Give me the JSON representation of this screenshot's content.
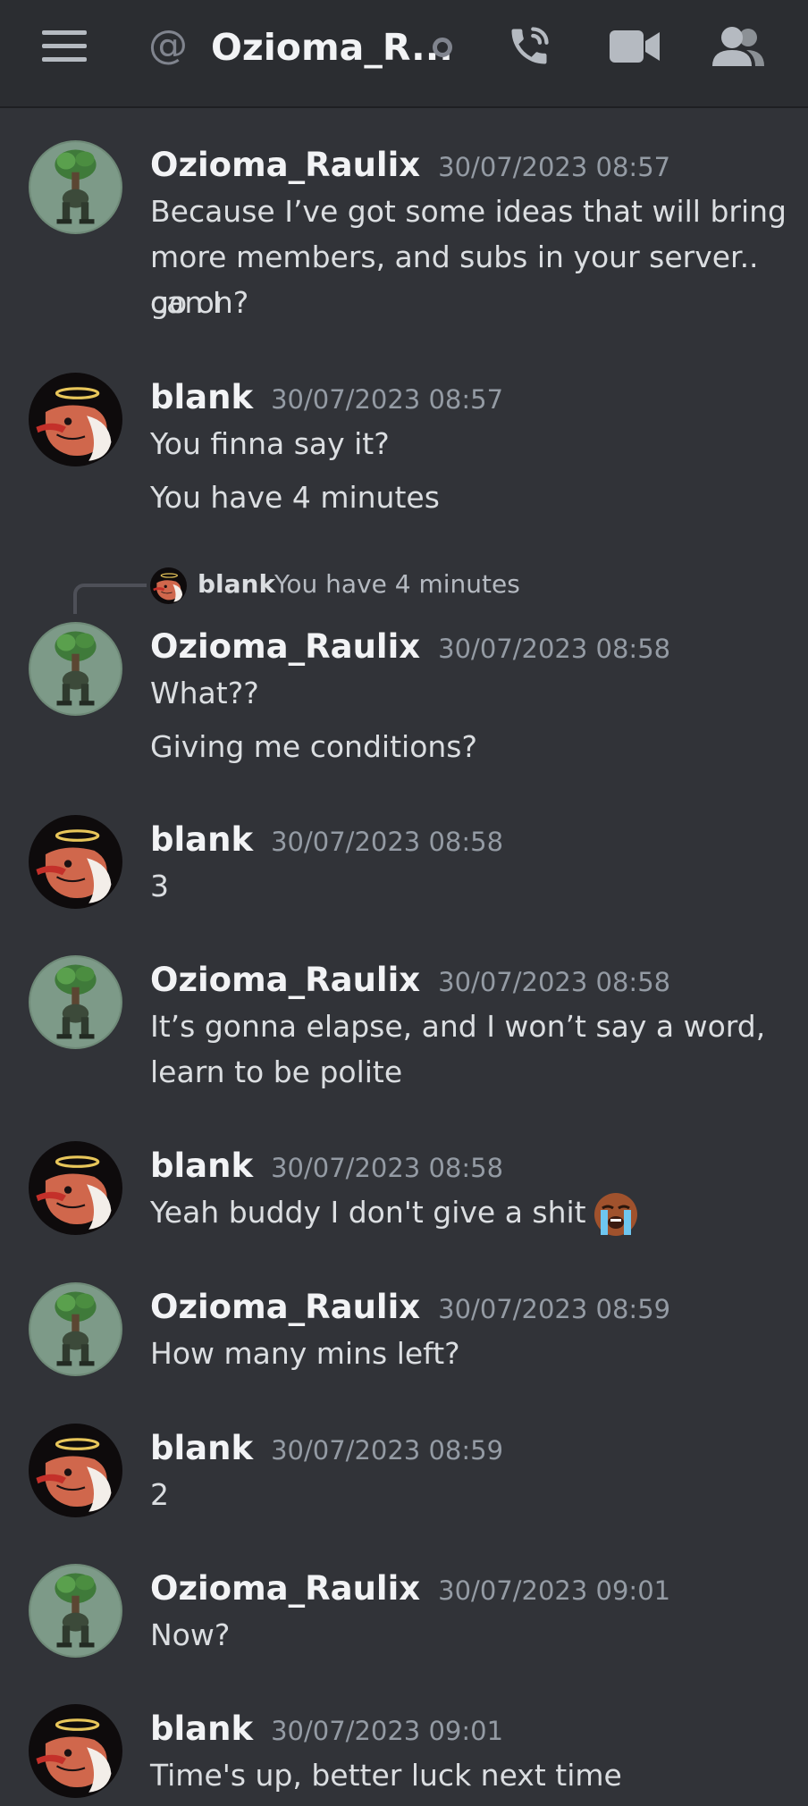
{
  "header": {
    "channel_prefix": "@",
    "channel_name": "Ozioma_R...",
    "icons": [
      "hamburger-menu-icon",
      "at-sign-icon",
      "status-offline-icon",
      "phone-call-icon",
      "video-call-icon",
      "members-icon"
    ]
  },
  "colors": {
    "background": "#313338",
    "header": "#2b2d31",
    "username": "#f2f3f5",
    "timestamp": "#949ba4",
    "text": "#dbdee1"
  },
  "messages": [
    {
      "author": "Ozioma_Raulix",
      "timestamp": "30/07/2023 08:57",
      "lines": [
        "Because I’ve got some ideas that will bring",
        "more members, and subs in your server.. can I",
        "go on?"
      ]
    },
    {
      "author": "blank",
      "timestamp": "30/07/2023 08:57",
      "lines": [
        "You finna say it?",
        "You have 4 minutes"
      ]
    },
    {
      "reply_to": {
        "author": "blank",
        "text": "You have 4 minutes"
      },
      "author": "Ozioma_Raulix",
      "timestamp": "30/07/2023 08:58",
      "lines": [
        "What??",
        "Giving me conditions?"
      ]
    },
    {
      "author": "blank",
      "timestamp": "30/07/2023 08:58",
      "lines": [
        "3"
      ]
    },
    {
      "author": "Ozioma_Raulix",
      "timestamp": "30/07/2023 08:58",
      "lines": [
        "It’s gonna elapse, and I won’t say a word,",
        "learn to be polite"
      ]
    },
    {
      "author": "blank",
      "timestamp": "30/07/2023 08:58",
      "lines": [
        "Yeah buddy I don't give a shit"
      ],
      "emoji": "loudly-crying-face-emoji"
    },
    {
      "author": "Ozioma_Raulix",
      "timestamp": "30/07/2023 08:59",
      "lines": [
        "How many mins left?"
      ]
    },
    {
      "author": "blank",
      "timestamp": "30/07/2023 08:59",
      "lines": [
        "2"
      ]
    },
    {
      "author": "Ozioma_Raulix",
      "timestamp": "30/07/2023 09:01",
      "lines": [
        "Now?"
      ]
    },
    {
      "author": "blank",
      "timestamp": "30/07/2023 09:01",
      "lines": [
        "Time's up, better luck next time"
      ]
    }
  ]
}
